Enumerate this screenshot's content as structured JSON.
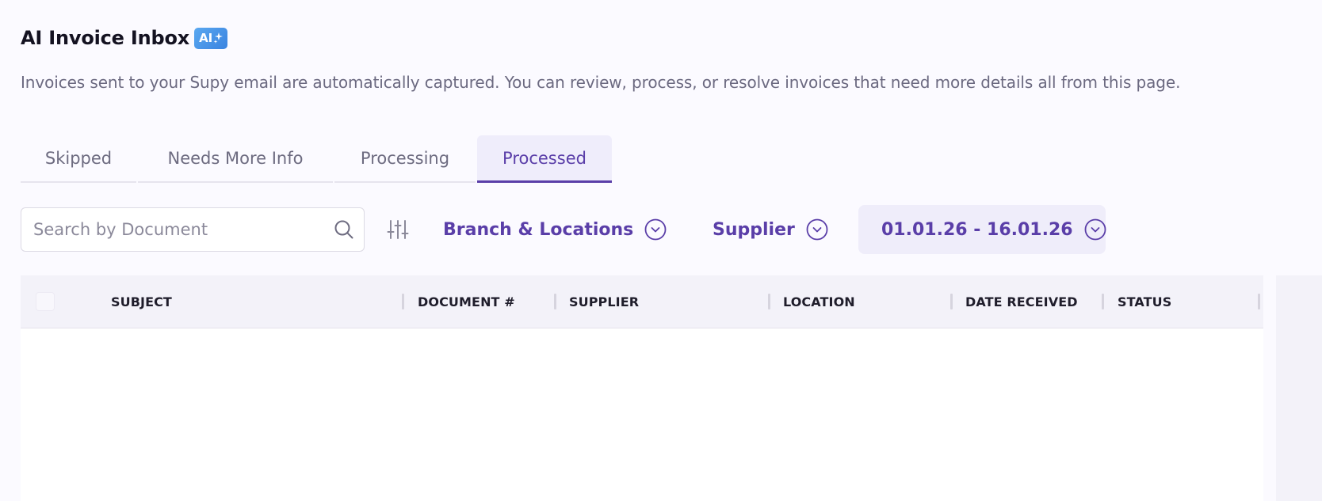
{
  "header": {
    "title": "AI Invoice Inbox",
    "badge": "AI",
    "description": "Invoices sent to your Supy email are automatically captured. You can review, process, or resolve invoices that need more details all from this page."
  },
  "tabs": [
    {
      "label": "Skipped",
      "active": false
    },
    {
      "label": "Needs More Info",
      "active": false
    },
    {
      "label": "Processing",
      "active": false
    },
    {
      "label": "Processed",
      "active": true
    }
  ],
  "filters": {
    "search_placeholder": "Search by Document",
    "branch_label": "Branch & Locations",
    "supplier_label": "Supplier",
    "date_range": "01.01.26 - 16.01.26"
  },
  "table": {
    "columns": [
      "SUBJECT",
      "DOCUMENT #",
      "SUPPLIER",
      "LOCATION",
      "DATE RECEIVED",
      "STATUS"
    ],
    "rows": []
  },
  "colors": {
    "accent": "#5a3ea8",
    "badge": "#3a83e0",
    "background": "#fbfaff"
  }
}
